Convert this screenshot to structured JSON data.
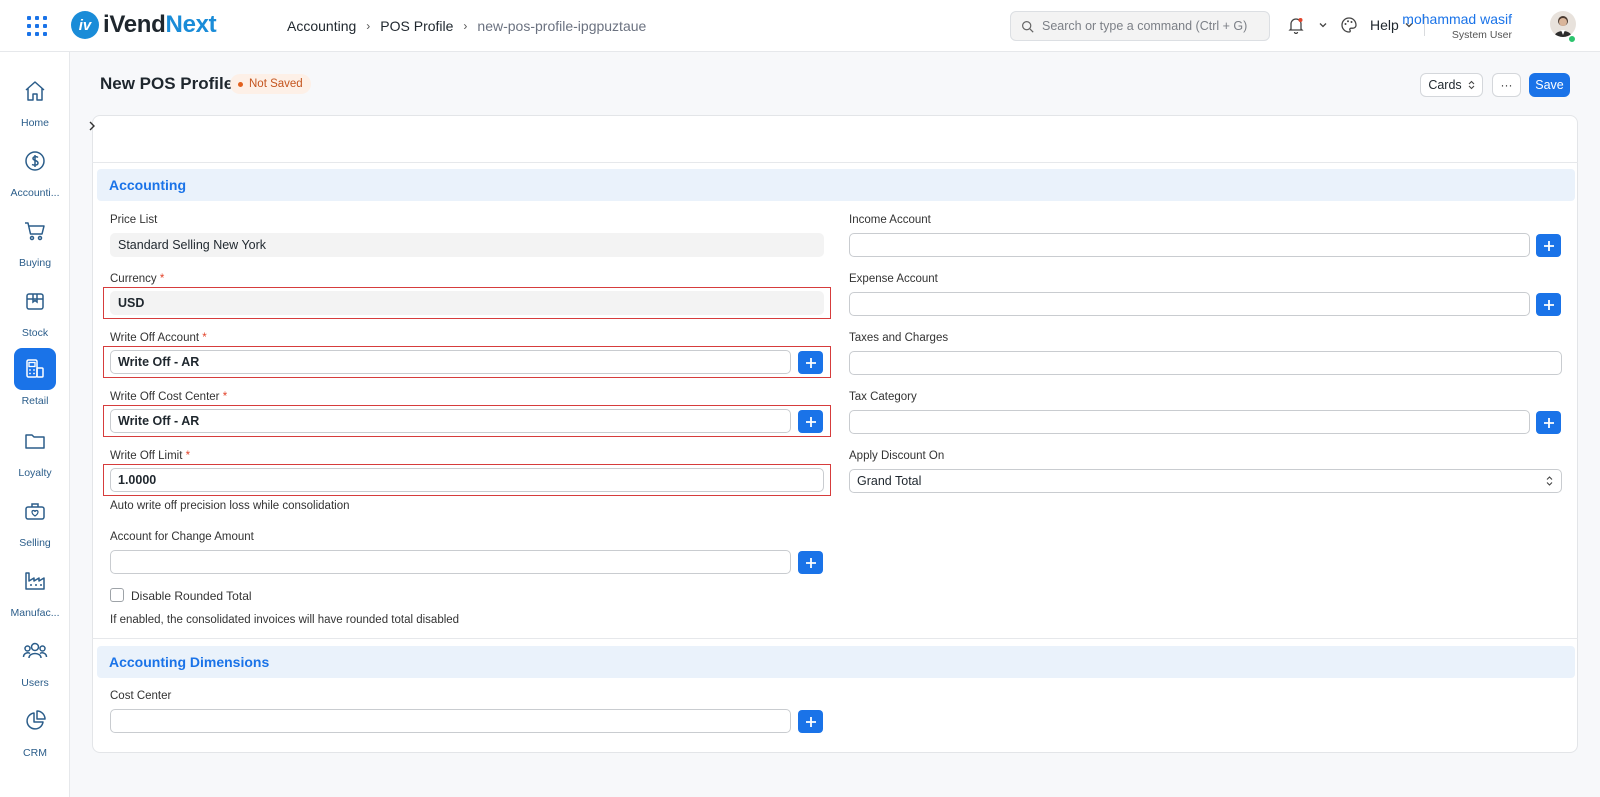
{
  "app": {
    "brand_part1": "iVend",
    "brand_part2": "Next",
    "brand_mark": "iv"
  },
  "breadcrumb": [
    "Accounting",
    "POS Profile",
    "new-pos-profile-ipgpuztaue"
  ],
  "search": {
    "placeholder": "Search or type a command (Ctrl + G)"
  },
  "nav": {
    "help_label": "Help"
  },
  "user": {
    "name": "mohammad wasif",
    "role": "System User"
  },
  "sidebar": {
    "items": [
      {
        "label": "Home",
        "icon": "home-icon"
      },
      {
        "label": "Accounti...",
        "icon": "dollar-icon"
      },
      {
        "label": "Buying",
        "icon": "cart-icon"
      },
      {
        "label": "Stock",
        "icon": "box-icon"
      },
      {
        "label": "Retail",
        "icon": "pos-icon",
        "active": true
      },
      {
        "label": "Loyalty",
        "icon": "folder-icon"
      },
      {
        "label": "Selling",
        "icon": "bag-icon"
      },
      {
        "label": "Manufac...",
        "icon": "factory-icon"
      },
      {
        "label": "Users",
        "icon": "users-icon"
      },
      {
        "label": "CRM",
        "icon": "pie-icon"
      }
    ]
  },
  "page": {
    "title": "New POS Profile",
    "status": "Not Saved",
    "view_label": "Cards",
    "more_label": "···",
    "save_label": "Save"
  },
  "sections": {
    "accounting": "Accounting",
    "dimensions": "Accounting Dimensions"
  },
  "fields": {
    "price_list": {
      "label": "Price List",
      "value": "Standard Selling New York"
    },
    "currency": {
      "label": "Currency",
      "value": "USD",
      "required_mark": "*"
    },
    "write_off_account": {
      "label": "Write Off Account",
      "value": "Write Off - AR",
      "required_mark": "*"
    },
    "write_off_cost_center": {
      "label": "Write Off Cost Center",
      "value": "Write Off - AR",
      "required_mark": "*"
    },
    "write_off_limit": {
      "label": "Write Off Limit",
      "value": "1.0000",
      "required_mark": "*",
      "description": "Auto write off precision loss while consolidation"
    },
    "change_account": {
      "label": "Account for Change Amount",
      "value": ""
    },
    "disable_rounded": {
      "label": "Disable Rounded Total",
      "description": "If enabled, the consolidated invoices will have rounded total disabled",
      "checked": false
    },
    "income_account": {
      "label": "Income Account",
      "value": ""
    },
    "expense_account": {
      "label": "Expense Account",
      "value": ""
    },
    "taxes_and_charges": {
      "label": "Taxes and Charges",
      "value": ""
    },
    "tax_category": {
      "label": "Tax Category",
      "value": ""
    },
    "apply_discount_on": {
      "label": "Apply Discount On",
      "value": "Grand Total"
    },
    "cost_center": {
      "label": "Cost Center",
      "value": ""
    }
  },
  "colors": {
    "accent": "#1a73e8",
    "error_border": "#d63c3c",
    "section_bg": "#eaf2fb",
    "status_text": "#c4541e"
  }
}
